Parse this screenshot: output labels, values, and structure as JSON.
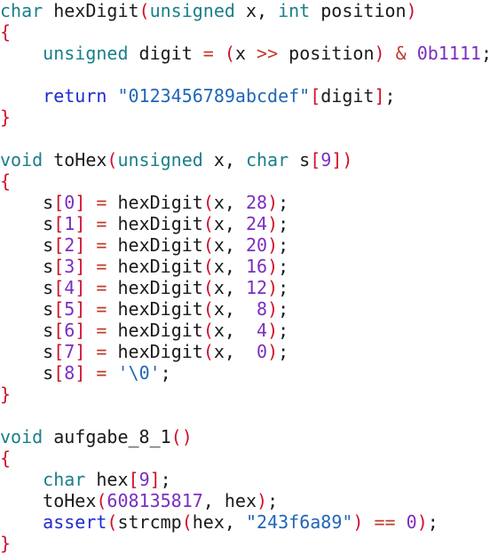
{
  "colors": {
    "background": "#ffffff",
    "type_keyword": "#1a7f8a",
    "control_keyword": "#1f2bd1",
    "bracket": "#d10f2b",
    "number": "#7a2fc0",
    "string": "#1f66b8",
    "operator": "#c0392b",
    "identifier": "#1a1a1a"
  },
  "code": {
    "lines": [
      [
        {
          "c": "kw-type",
          "t": "char"
        },
        {
          "c": "pl",
          "t": " hexDigit"
        },
        {
          "c": "br",
          "t": "("
        },
        {
          "c": "kw-type",
          "t": "unsigned"
        },
        {
          "c": "pl",
          "t": " x, "
        },
        {
          "c": "kw-type",
          "t": "int"
        },
        {
          "c": "pl",
          "t": " position"
        },
        {
          "c": "br",
          "t": ")"
        }
      ],
      [
        {
          "c": "br",
          "t": "{"
        }
      ],
      [
        {
          "c": "pl",
          "t": "    "
        },
        {
          "c": "kw-type",
          "t": "unsigned"
        },
        {
          "c": "pl",
          "t": " digit "
        },
        {
          "c": "op",
          "t": "="
        },
        {
          "c": "pl",
          "t": " "
        },
        {
          "c": "br",
          "t": "("
        },
        {
          "c": "pl",
          "t": "x "
        },
        {
          "c": "op",
          "t": ">>"
        },
        {
          "c": "pl",
          "t": " position"
        },
        {
          "c": "br",
          "t": ")"
        },
        {
          "c": "pl",
          "t": " "
        },
        {
          "c": "op",
          "t": "&"
        },
        {
          "c": "pl",
          "t": " "
        },
        {
          "c": "num",
          "t": "0b1111"
        },
        {
          "c": "pl",
          "t": ";"
        }
      ],
      [],
      [
        {
          "c": "pl",
          "t": "    "
        },
        {
          "c": "kw-ctrl",
          "t": "return"
        },
        {
          "c": "pl",
          "t": " "
        },
        {
          "c": "str",
          "t": "\"0123456789abcdef\""
        },
        {
          "c": "br",
          "t": "["
        },
        {
          "c": "pl",
          "t": "digit"
        },
        {
          "c": "br",
          "t": "]"
        },
        {
          "c": "pl",
          "t": ";"
        }
      ],
      [
        {
          "c": "br",
          "t": "}"
        }
      ],
      [],
      [
        {
          "c": "kw-type",
          "t": "void"
        },
        {
          "c": "pl",
          "t": " toHex"
        },
        {
          "c": "br",
          "t": "("
        },
        {
          "c": "kw-type",
          "t": "unsigned"
        },
        {
          "c": "pl",
          "t": " x, "
        },
        {
          "c": "kw-type",
          "t": "char"
        },
        {
          "c": "pl",
          "t": " s"
        },
        {
          "c": "br",
          "t": "["
        },
        {
          "c": "num",
          "t": "9"
        },
        {
          "c": "br",
          "t": "]"
        },
        {
          "c": "br",
          "t": ")"
        }
      ],
      [
        {
          "c": "br",
          "t": "{"
        }
      ],
      [
        {
          "c": "pl",
          "t": "    s"
        },
        {
          "c": "br",
          "t": "["
        },
        {
          "c": "num",
          "t": "0"
        },
        {
          "c": "br",
          "t": "]"
        },
        {
          "c": "pl",
          "t": " "
        },
        {
          "c": "op",
          "t": "="
        },
        {
          "c": "pl",
          "t": " hexDigit"
        },
        {
          "c": "br",
          "t": "("
        },
        {
          "c": "pl",
          "t": "x, "
        },
        {
          "c": "num",
          "t": "28"
        },
        {
          "c": "br",
          "t": ")"
        },
        {
          "c": "pl",
          "t": ";"
        }
      ],
      [
        {
          "c": "pl",
          "t": "    s"
        },
        {
          "c": "br",
          "t": "["
        },
        {
          "c": "num",
          "t": "1"
        },
        {
          "c": "br",
          "t": "]"
        },
        {
          "c": "pl",
          "t": " "
        },
        {
          "c": "op",
          "t": "="
        },
        {
          "c": "pl",
          "t": " hexDigit"
        },
        {
          "c": "br",
          "t": "("
        },
        {
          "c": "pl",
          "t": "x, "
        },
        {
          "c": "num",
          "t": "24"
        },
        {
          "c": "br",
          "t": ")"
        },
        {
          "c": "pl",
          "t": ";"
        }
      ],
      [
        {
          "c": "pl",
          "t": "    s"
        },
        {
          "c": "br",
          "t": "["
        },
        {
          "c": "num",
          "t": "2"
        },
        {
          "c": "br",
          "t": "]"
        },
        {
          "c": "pl",
          "t": " "
        },
        {
          "c": "op",
          "t": "="
        },
        {
          "c": "pl",
          "t": " hexDigit"
        },
        {
          "c": "br",
          "t": "("
        },
        {
          "c": "pl",
          "t": "x, "
        },
        {
          "c": "num",
          "t": "20"
        },
        {
          "c": "br",
          "t": ")"
        },
        {
          "c": "pl",
          "t": ";"
        }
      ],
      [
        {
          "c": "pl",
          "t": "    s"
        },
        {
          "c": "br",
          "t": "["
        },
        {
          "c": "num",
          "t": "3"
        },
        {
          "c": "br",
          "t": "]"
        },
        {
          "c": "pl",
          "t": " "
        },
        {
          "c": "op",
          "t": "="
        },
        {
          "c": "pl",
          "t": " hexDigit"
        },
        {
          "c": "br",
          "t": "("
        },
        {
          "c": "pl",
          "t": "x, "
        },
        {
          "c": "num",
          "t": "16"
        },
        {
          "c": "br",
          "t": ")"
        },
        {
          "c": "pl",
          "t": ";"
        }
      ],
      [
        {
          "c": "pl",
          "t": "    s"
        },
        {
          "c": "br",
          "t": "["
        },
        {
          "c": "num",
          "t": "4"
        },
        {
          "c": "br",
          "t": "]"
        },
        {
          "c": "pl",
          "t": " "
        },
        {
          "c": "op",
          "t": "="
        },
        {
          "c": "pl",
          "t": " hexDigit"
        },
        {
          "c": "br",
          "t": "("
        },
        {
          "c": "pl",
          "t": "x, "
        },
        {
          "c": "num",
          "t": "12"
        },
        {
          "c": "br",
          "t": ")"
        },
        {
          "c": "pl",
          "t": ";"
        }
      ],
      [
        {
          "c": "pl",
          "t": "    s"
        },
        {
          "c": "br",
          "t": "["
        },
        {
          "c": "num",
          "t": "5"
        },
        {
          "c": "br",
          "t": "]"
        },
        {
          "c": "pl",
          "t": " "
        },
        {
          "c": "op",
          "t": "="
        },
        {
          "c": "pl",
          "t": " hexDigit"
        },
        {
          "c": "br",
          "t": "("
        },
        {
          "c": "pl",
          "t": "x,  "
        },
        {
          "c": "num",
          "t": "8"
        },
        {
          "c": "br",
          "t": ")"
        },
        {
          "c": "pl",
          "t": ";"
        }
      ],
      [
        {
          "c": "pl",
          "t": "    s"
        },
        {
          "c": "br",
          "t": "["
        },
        {
          "c": "num",
          "t": "6"
        },
        {
          "c": "br",
          "t": "]"
        },
        {
          "c": "pl",
          "t": " "
        },
        {
          "c": "op",
          "t": "="
        },
        {
          "c": "pl",
          "t": " hexDigit"
        },
        {
          "c": "br",
          "t": "("
        },
        {
          "c": "pl",
          "t": "x,  "
        },
        {
          "c": "num",
          "t": "4"
        },
        {
          "c": "br",
          "t": ")"
        },
        {
          "c": "pl",
          "t": ";"
        }
      ],
      [
        {
          "c": "pl",
          "t": "    s"
        },
        {
          "c": "br",
          "t": "["
        },
        {
          "c": "num",
          "t": "7"
        },
        {
          "c": "br",
          "t": "]"
        },
        {
          "c": "pl",
          "t": " "
        },
        {
          "c": "op",
          "t": "="
        },
        {
          "c": "pl",
          "t": " hexDigit"
        },
        {
          "c": "br",
          "t": "("
        },
        {
          "c": "pl",
          "t": "x,  "
        },
        {
          "c": "num",
          "t": "0"
        },
        {
          "c": "br",
          "t": ")"
        },
        {
          "c": "pl",
          "t": ";"
        }
      ],
      [
        {
          "c": "pl",
          "t": "    s"
        },
        {
          "c": "br",
          "t": "["
        },
        {
          "c": "num",
          "t": "8"
        },
        {
          "c": "br",
          "t": "]"
        },
        {
          "c": "pl",
          "t": " "
        },
        {
          "c": "op",
          "t": "="
        },
        {
          "c": "pl",
          "t": " "
        },
        {
          "c": "str",
          "t": "'\\0'"
        },
        {
          "c": "pl",
          "t": ";"
        }
      ],
      [
        {
          "c": "br",
          "t": "}"
        }
      ],
      [],
      [
        {
          "c": "kw-type",
          "t": "void"
        },
        {
          "c": "pl",
          "t": " aufgabe_8_1"
        },
        {
          "c": "br",
          "t": "()"
        }
      ],
      [
        {
          "c": "br",
          "t": "{"
        }
      ],
      [
        {
          "c": "pl",
          "t": "    "
        },
        {
          "c": "kw-type",
          "t": "char"
        },
        {
          "c": "pl",
          "t": " hex"
        },
        {
          "c": "br",
          "t": "["
        },
        {
          "c": "num",
          "t": "9"
        },
        {
          "c": "br",
          "t": "]"
        },
        {
          "c": "pl",
          "t": ";"
        }
      ],
      [
        {
          "c": "pl",
          "t": "    toHex"
        },
        {
          "c": "br",
          "t": "("
        },
        {
          "c": "num",
          "t": "608135817"
        },
        {
          "c": "pl",
          "t": ", hex"
        },
        {
          "c": "br",
          "t": ")"
        },
        {
          "c": "pl",
          "t": ";"
        }
      ],
      [
        {
          "c": "pl",
          "t": "    "
        },
        {
          "c": "kw-ctrl",
          "t": "assert"
        },
        {
          "c": "br",
          "t": "("
        },
        {
          "c": "pl",
          "t": "strcmp"
        },
        {
          "c": "br",
          "t": "("
        },
        {
          "c": "pl",
          "t": "hex, "
        },
        {
          "c": "str",
          "t": "\"243f6a89\""
        },
        {
          "c": "br",
          "t": ")"
        },
        {
          "c": "pl",
          "t": " "
        },
        {
          "c": "op",
          "t": "=="
        },
        {
          "c": "pl",
          "t": " "
        },
        {
          "c": "num",
          "t": "0"
        },
        {
          "c": "br",
          "t": ")"
        },
        {
          "c": "pl",
          "t": ";"
        }
      ],
      [
        {
          "c": "br",
          "t": "}"
        }
      ]
    ]
  }
}
